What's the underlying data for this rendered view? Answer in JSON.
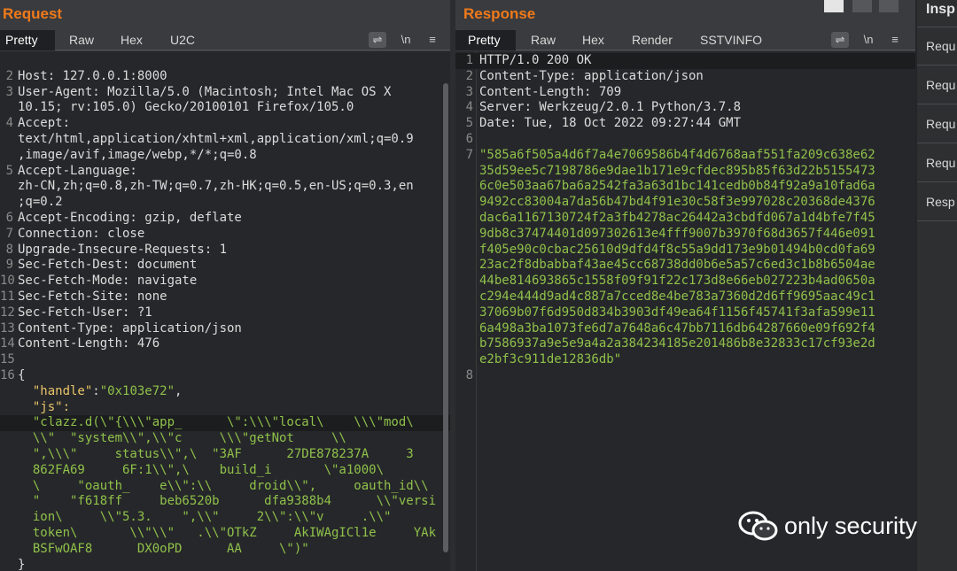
{
  "request": {
    "title": "Request",
    "tabs": [
      "Pretty",
      "Raw",
      "Hex",
      "U2C"
    ],
    "active_tab": "Pretty",
    "icons": {
      "wrap": "wrap-icon",
      "newline": "\\n",
      "menu": "menu-icon"
    },
    "lines": [
      {
        "n": "",
        "t": "                  ",
        "k": "plain"
      },
      {
        "n": "2",
        "t": "Host: 127.0.0.1:8000"
      },
      {
        "n": "3",
        "t": "User-Agent: Mozilla/5.0 (Macintosh; Intel Mac OS X"
      },
      {
        "n": "",
        "t": "10.15; rv:105.0) Gecko/20100101 Firefox/105.0"
      },
      {
        "n": "4",
        "t": "Accept:"
      },
      {
        "n": "",
        "t": "text/html,application/xhtml+xml,application/xml;q=0.9"
      },
      {
        "n": "",
        "t": ",image/avif,image/webp,*/*;q=0.8"
      },
      {
        "n": "5",
        "t": "Accept-Language:"
      },
      {
        "n": "",
        "t": "zh-CN,zh;q=0.8,zh-TW;q=0.7,zh-HK;q=0.5,en-US;q=0.3,en"
      },
      {
        "n": "",
        "t": ";q=0.2"
      },
      {
        "n": "6",
        "t": "Accept-Encoding: gzip, deflate"
      },
      {
        "n": "7",
        "t": "Connection: close"
      },
      {
        "n": "8",
        "t": "Upgrade-Insecure-Requests: 1"
      },
      {
        "n": "9",
        "t": "Sec-Fetch-Dest: document"
      },
      {
        "n": "10",
        "t": "Sec-Fetch-Mode: navigate"
      },
      {
        "n": "11",
        "t": "Sec-Fetch-Site: none"
      },
      {
        "n": "12",
        "t": "Sec-Fetch-User: ?1"
      },
      {
        "n": "13",
        "t": "Content-Type: application/json"
      },
      {
        "n": "14",
        "t": "Content-Length: 476"
      },
      {
        "n": "15",
        "t": ""
      },
      {
        "n": "16",
        "t": "{"
      },
      {
        "n": "",
        "t": "  \"handle\":\"0x103e72\",",
        "k": "kv"
      },
      {
        "n": "",
        "t": "  \"js\":",
        "k": "key"
      },
      {
        "n": "",
        "t": "  \"clazz.d(\\\"{\\\\\\\"app_      \\\":\\\\\\\"local\\    \\\\\\\"mod\\",
        "k": "str",
        "hl": true
      },
      {
        "n": "",
        "t": "  \\\\\"  \"system\\\\\",\\\\\"c     \\\\\\\"getNot     \\\\",
        "k": "str"
      },
      {
        "n": "",
        "t": "  \",\\\\\\\"     status\\\\\",\\  \"3AF      27DE878237A     3",
        "k": "str"
      },
      {
        "n": "",
        "t": "  862FA69     6F:1\\\\\",\\    build_i       \\\"a1000\\",
        "k": "str"
      },
      {
        "n": "",
        "t": "  \\     \"oauth_    e\\\\\":\\\\     droid\\\\\",     oauth_id\\\\",
        "k": "str"
      },
      {
        "n": "",
        "t": "  \"    \"f618ff     beb6520b      dfa9388b4      \\\\\"versi",
        "k": "str"
      },
      {
        "n": "",
        "t": "  ion\\     \\\\\"5.3.    \",\\\\\"     2\\\\\":\\\\\"v     .\\\\\"",
        "k": "str"
      },
      {
        "n": "",
        "t": "  token\\       \\\\\"\\\\\"   .\\\\\"OTkZ     AkIWAgICl1e     YAk",
        "k": "str"
      },
      {
        "n": "",
        "t": "  BSFwOAF8      DX0oPD      AA     \\\")\"",
        "k": "str"
      },
      {
        "n": "",
        "t": "}"
      }
    ]
  },
  "response": {
    "title": "Response",
    "tabs": [
      "Pretty",
      "Raw",
      "Hex",
      "Render",
      "SSTVINFO"
    ],
    "active_tab": "Pretty",
    "icons": {
      "wrap": "wrap-icon",
      "newline": "\\n",
      "menu": "menu-icon"
    },
    "lines": [
      {
        "n": "1",
        "t": "HTTP/1.0 200 OK",
        "hl": true
      },
      {
        "n": "2",
        "t": "Content-Type: application/json"
      },
      {
        "n": "3",
        "t": "Content-Length: 709"
      },
      {
        "n": "4",
        "t": "Server: Werkzeug/2.0.1 Python/3.7.8"
      },
      {
        "n": "5",
        "t": "Date: Tue, 18 Oct 2022 09:27:44 GMT"
      },
      {
        "n": "6",
        "t": ""
      },
      {
        "n": "7",
        "t": "\"585a6f505a4d6f7a4e7069586b4f4d6768aaf551fa209c638e62",
        "k": "str"
      },
      {
        "n": "",
        "t": "35d59ee5c7198786e9dae1b171e9cfdec895b85f63d22b5155473",
        "k": "str"
      },
      {
        "n": "",
        "t": "6c0e503aa67ba6a2542fa3a63d1bc141cedb0b84f92a9a10fad6a",
        "k": "str"
      },
      {
        "n": "",
        "t": "9492cc83004a7da56b47bd4f91e30c58f3e997028c20368de4376",
        "k": "str"
      },
      {
        "n": "",
        "t": "dac6a1167130724f2a3fb4278ac26442a3cbdfd067a1d4bfe7f45",
        "k": "str"
      },
      {
        "n": "",
        "t": "9db8c37474401d097302613e4fff9007b3970f68d3657f446e091",
        "k": "str"
      },
      {
        "n": "",
        "t": "f405e90c0cbac25610d9dfd4f8c55a9dd173e9b01494b0cd0fa69",
        "k": "str"
      },
      {
        "n": "",
        "t": "23ac2f8dbabbaf43ae45cc68738dd0b6e5a57c6ed3c1b8b6504ae",
        "k": "str"
      },
      {
        "n": "",
        "t": "44be814693865c1558f09f91f22c173d8e66eb027223b4ad0650a",
        "k": "str"
      },
      {
        "n": "",
        "t": "c294e444d9ad4c887a7cced8e4be783a7360d2d6ff9695aac49c1",
        "k": "str"
      },
      {
        "n": "",
        "t": "37069b07f6d950d834b3903df49ea64f1156f45741f3afa599e11",
        "k": "str"
      },
      {
        "n": "",
        "t": "6a498a3ba1073fe6d7a7648a6c47bb7116db64287660e09f692f4",
        "k": "str"
      },
      {
        "n": "",
        "t": "b7586937a9e5e9a4a2a384234185e201486b8e32833c17cf93e2d",
        "k": "str"
      },
      {
        "n": "",
        "t": "e2bf3c911de12836db\"",
        "k": "str"
      },
      {
        "n": "8",
        "t": ""
      }
    ]
  },
  "inspector": {
    "title": "Insp",
    "items": [
      "Requ",
      "Requ",
      "Requ",
      "Requ",
      "Resp"
    ]
  },
  "watermark": {
    "text": "only security",
    "icon": "wechat-icon"
  },
  "colors": {
    "accent": "#f07a1a",
    "string": "#8fc14a",
    "key": "#e9c46a"
  }
}
